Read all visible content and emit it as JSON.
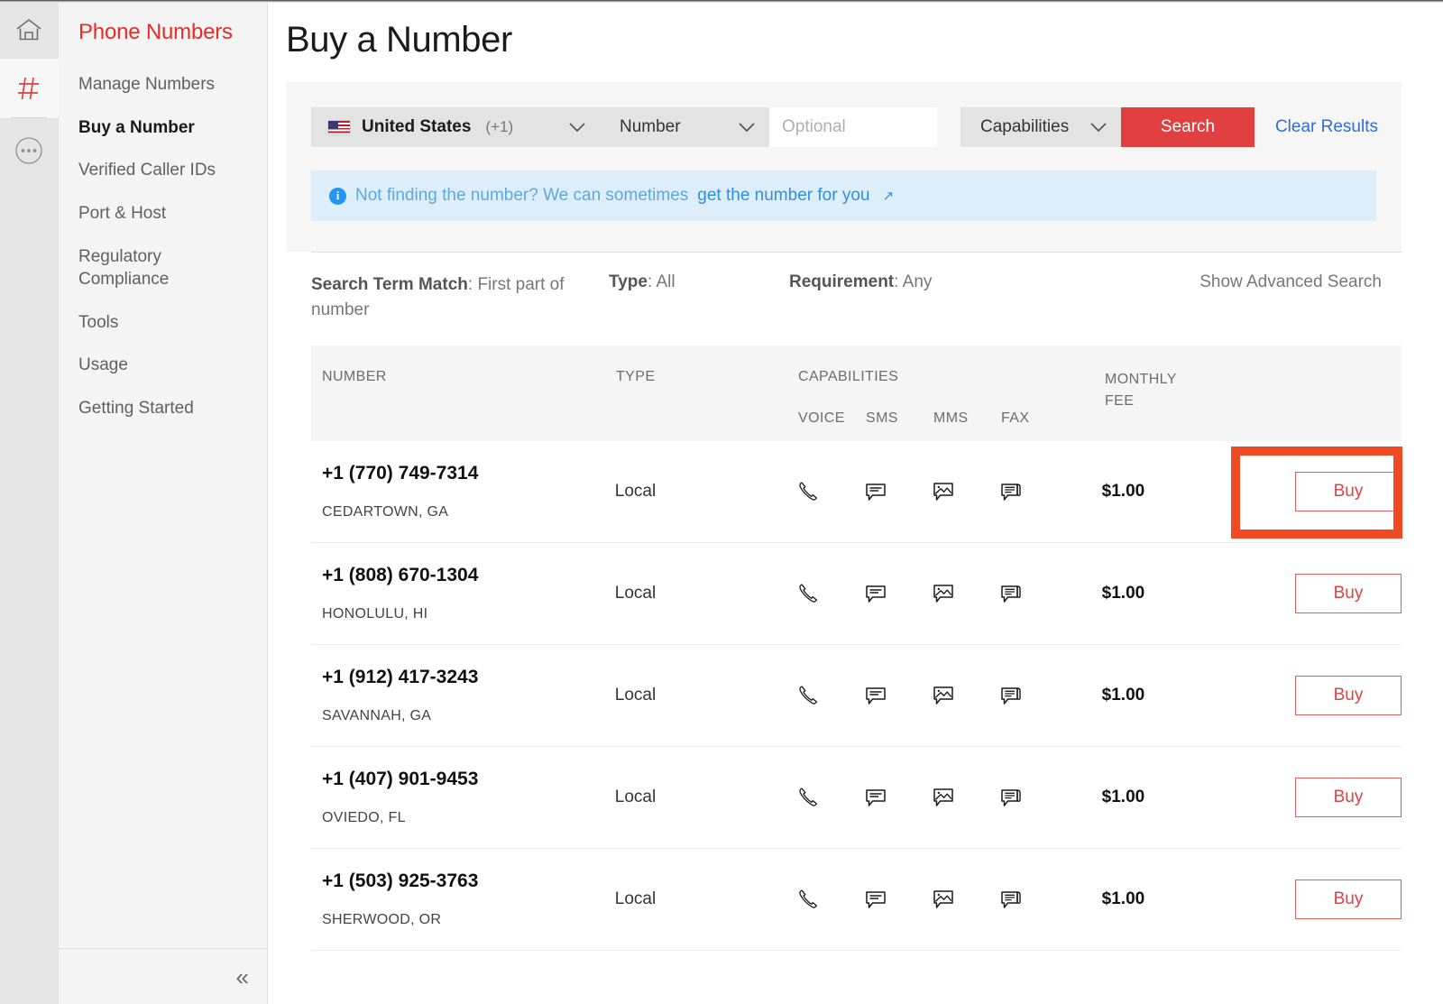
{
  "rail": {
    "items": [
      {
        "name": "home-icon",
        "label": "Home"
      },
      {
        "name": "hash-icon",
        "label": "Phone Numbers"
      },
      {
        "name": "more-icon",
        "label": "More"
      }
    ]
  },
  "sidebar": {
    "title": "Phone Numbers",
    "items": [
      {
        "label": "Manage Numbers",
        "active": false
      },
      {
        "label": "Buy a Number",
        "active": true
      },
      {
        "label": "Verified Caller IDs",
        "active": false
      },
      {
        "label": "Port & Host",
        "active": false
      },
      {
        "label": "Regulatory Compliance",
        "active": false
      },
      {
        "label": "Tools",
        "active": false
      },
      {
        "label": "Usage",
        "active": false
      },
      {
        "label": "Getting Started",
        "active": false
      }
    ],
    "collapse_glyph": "«"
  },
  "page": {
    "title": "Buy a Number"
  },
  "search": {
    "country": "United States",
    "country_code": "(+1)",
    "type_label": "Number",
    "optional_value": "",
    "optional_placeholder": "Optional",
    "capabilities_label": "Capabilities",
    "search_button": "Search",
    "clear_link": "Clear Results",
    "chevron_glyph": "⌄"
  },
  "banner": {
    "info_glyph": "i",
    "text": "Not finding the number? We can sometimes",
    "link": "get the number for you",
    "ext_glyph": "↗"
  },
  "filters": {
    "search_term_match_label": "Search Term Match",
    "search_term_match_value": ": First part of number",
    "type_label": "Type",
    "type_value": ": All",
    "requirement_label": "Requirement",
    "requirement_value": ": Any",
    "advanced_link": "Show Advanced Search"
  },
  "table": {
    "headers": {
      "number": "NUMBER",
      "type": "TYPE",
      "capabilities": "CAPABILITIES",
      "monthly_fee_line1": "MONTHLY",
      "monthly_fee_line2": "FEE"
    },
    "subheaders": [
      "VOICE",
      "SMS",
      "MMS",
      "FAX"
    ],
    "buy_label": "Buy",
    "rows": [
      {
        "number": "+1 (770) 749-7314",
        "location": "CEDARTOWN, GA",
        "type": "Local",
        "voice": true,
        "sms": true,
        "mms": true,
        "fax": true,
        "fee": "$1.00",
        "buy": "Buy",
        "highlighted": true
      },
      {
        "number": "+1 (808) 670-1304",
        "location": "HONOLULU, HI",
        "type": "Local",
        "voice": true,
        "sms": true,
        "mms": true,
        "fax": true,
        "fee": "$1.00",
        "buy": "Buy",
        "highlighted": false
      },
      {
        "number": "+1 (912) 417-3243",
        "location": "SAVANNAH, GA",
        "type": "Local",
        "voice": true,
        "sms": true,
        "mms": true,
        "fax": true,
        "fee": "$1.00",
        "buy": "Buy",
        "highlighted": false
      },
      {
        "number": "+1 (407) 901-9453",
        "location": "OVIEDO, FL",
        "type": "Local",
        "voice": true,
        "sms": true,
        "mms": true,
        "fax": true,
        "fee": "$1.00",
        "buy": "Buy",
        "highlighted": false
      },
      {
        "number": "+1 (503) 925-3763",
        "location": "SHERWOOD, OR",
        "type": "Local",
        "voice": true,
        "sms": true,
        "mms": true,
        "fax": true,
        "fee": "$1.00",
        "buy": "Buy",
        "highlighted": false
      }
    ]
  },
  "colors": {
    "brand_red": "#e52d27",
    "search_red": "#e0403f",
    "highlight_orange": "#ef4a23",
    "link_blue": "#2f6fd0",
    "banner_bg": "#ddeefa"
  }
}
